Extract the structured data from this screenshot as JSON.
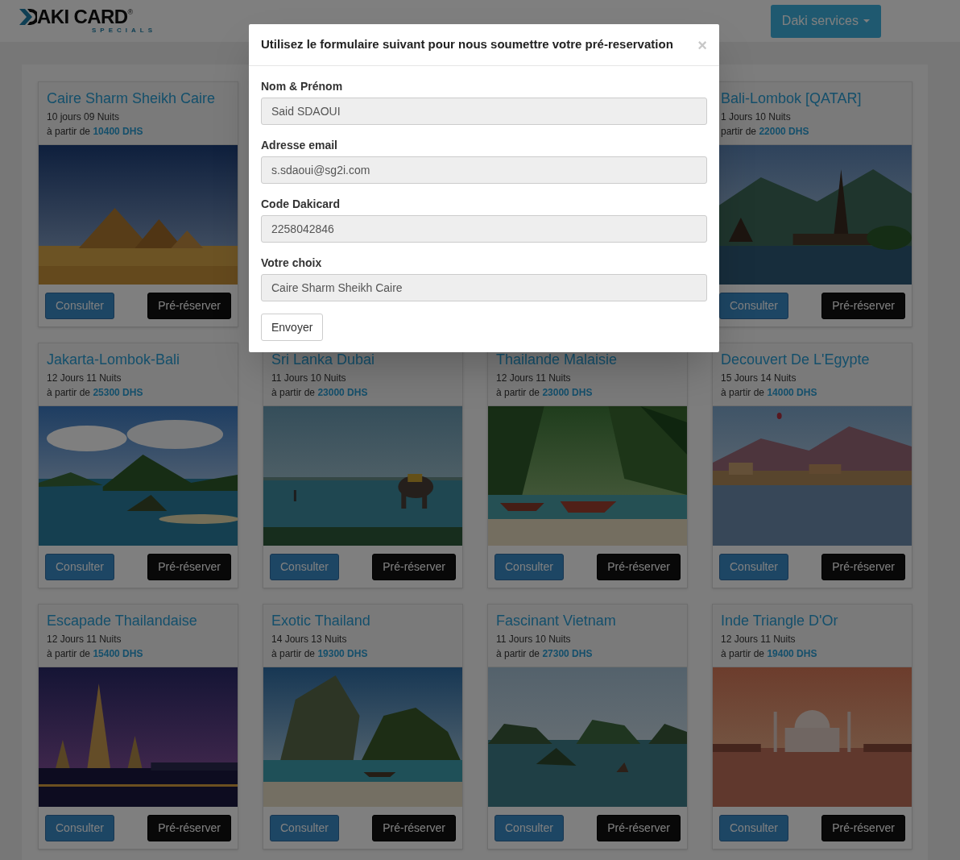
{
  "header": {
    "logo": {
      "text": "AKI CARD",
      "mark": "®",
      "tagline": "SPECIALS"
    },
    "services_button": {
      "label": "Daki services"
    }
  },
  "cards": [
    {
      "title": "Caire Sharm Sheikh Caire",
      "duration": "10 jours 09 Nuits",
      "price_prefix": "à partir de",
      "price": "10400 DHS",
      "buttons": [
        "Consulter",
        "Pré-réserver"
      ]
    },
    {
      "title": "Bali-Lombok [QATAR]",
      "duration": "1 Jours 10 Nuits",
      "price_prefix": "partir de",
      "price": "22000 DHS",
      "buttons": [
        "Consulter",
        "Pré-réserver"
      ]
    },
    {
      "title": "Jakarta-Lombok-Bali",
      "duration": "12 Jours 11 Nuits",
      "price_prefix": "à partir de",
      "price": "25300 DHS",
      "buttons": [
        "Consulter",
        "Pré-réserver"
      ]
    },
    {
      "title": "Sri Lanka Dubai",
      "duration": "11 Jours 10 Nuits",
      "price_prefix": "à partir de",
      "price": "23000 DHS",
      "buttons": [
        "Consulter",
        "Pré-réserver"
      ]
    },
    {
      "title": "Thailande Malaisie",
      "duration": "12 Jours 11 Nuits",
      "price_prefix": "à partir de",
      "price": "23000 DHS",
      "buttons": [
        "Consulter",
        "Pré-réserver"
      ]
    },
    {
      "title": "Decouvert De L'Egypte",
      "duration": "15 Jours 14 Nuits",
      "price_prefix": "à partir de",
      "price": "14000 DHS",
      "buttons": [
        "Consulter",
        "Pré-réserver"
      ]
    },
    {
      "title": "Escapade Thailandaise",
      "duration": "12 Jours 11 Nuits",
      "price_prefix": "à partir de",
      "price": "15400 DHS",
      "buttons": [
        "Consulter",
        "Pré-réserver"
      ]
    },
    {
      "title": "Exotic Thailand",
      "duration": "14 Jours 13 Nuits",
      "price_prefix": "à partir de",
      "price": "19300 DHS",
      "buttons": [
        "Consulter",
        "Pré-réserver"
      ]
    },
    {
      "title": "Fascinant Vietnam",
      "duration": "11 Jours 10 Nuits",
      "price_prefix": "à partir de",
      "price": "27300 DHS",
      "buttons": [
        "Consulter",
        "Pré-réserver"
      ]
    },
    {
      "title": "Inde Triangle D'Or",
      "duration": "12 Jours 11 Nuits",
      "price_prefix": "à partir de",
      "price": "19400 DHS",
      "buttons": [
        "Consulter",
        "Pré-réserver"
      ]
    }
  ],
  "modal": {
    "title": "Utilisez le formulaire suivant pour nous soumettre votre pré-reservation",
    "close": "×",
    "fields": [
      {
        "label": "Nom & Prénom",
        "value": "Said SDAOUI"
      },
      {
        "label": "Adresse email",
        "value": "s.sdaoui@sg2i.com"
      },
      {
        "label": "Code Dakicard",
        "value": "2258042846"
      },
      {
        "label": "Votre choix",
        "value": "Caire Sharm Sheikh Caire"
      }
    ],
    "submit": "Envoyer"
  }
}
